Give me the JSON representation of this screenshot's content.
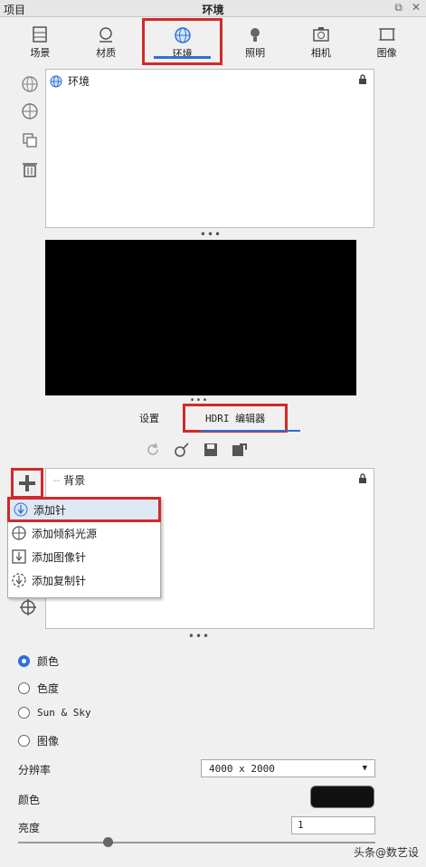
{
  "titlebar": {
    "left": "项目",
    "title": "环境"
  },
  "tabs": [
    {
      "label": "场景",
      "icon": "scene-icon"
    },
    {
      "label": "材质",
      "icon": "material-icon"
    },
    {
      "label": "环境",
      "icon": "globe-icon",
      "active": true
    },
    {
      "label": "照明",
      "icon": "bulb-icon"
    },
    {
      "label": "相机",
      "icon": "camera-icon"
    },
    {
      "label": "图像",
      "icon": "image-icon"
    }
  ],
  "env_list": {
    "item_label": "环境"
  },
  "subtabs": {
    "settings": "设置",
    "hdri_editor": "HDRI 编辑器"
  },
  "tree2": {
    "item_label": "背景"
  },
  "add_menu": [
    {
      "label": "添加针"
    },
    {
      "label": "添加倾斜光源"
    },
    {
      "label": "添加图像针"
    },
    {
      "label": "添加复制针"
    }
  ],
  "background": {
    "options": [
      "颜色",
      "色度",
      "Sun & Sky",
      "图像"
    ],
    "selected": "颜色",
    "resolution_label": "分辨率",
    "resolution_value": "4000 x 2000",
    "color_label": "颜色",
    "color_value": "#111111",
    "brightness_label": "亮度",
    "brightness_value": "1",
    "brightness_slider": 0.25
  },
  "dots": "•••",
  "watermark": "头条@数艺设",
  "colors": {
    "accent": "#2f6fd6",
    "highlight": "#d12a2a"
  }
}
